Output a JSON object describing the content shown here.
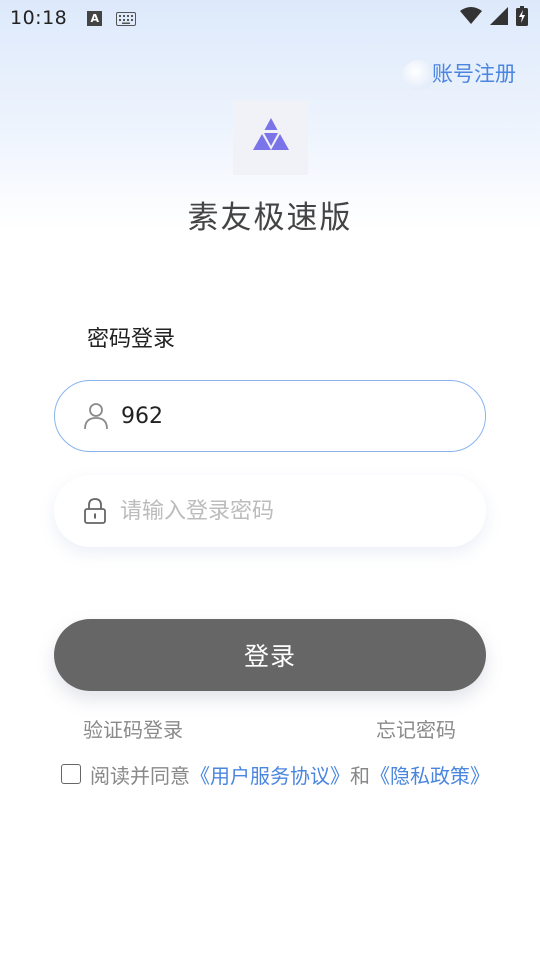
{
  "status_bar": {
    "time": "10:18",
    "indicator_letter": "A",
    "icons": [
      "text-notification-icon",
      "keyboard-icon",
      "wifi-icon",
      "signal-icon",
      "battery-charging-icon"
    ]
  },
  "header": {
    "register_label": "账号注册"
  },
  "app": {
    "name": "素友极速版",
    "logo_icon": "triforce-logo-icon"
  },
  "login": {
    "mode_title": "密码登录",
    "account_value": "962",
    "password_placeholder": "请输入登录密码",
    "submit_label": "登录",
    "sms_login_label": "验证码登录",
    "forgot_password_label": "忘记密码"
  },
  "agreement": {
    "checked": false,
    "prefix": "阅读并同意",
    "terms_link": "《用户服务协议》",
    "connector": "和",
    "privacy_link": "《隐私政策》"
  },
  "colors": {
    "accent": "#4a86e0",
    "logo": "#7b74e8",
    "button_bg": "#666666",
    "input_focus_border": "#8ab4ee"
  }
}
